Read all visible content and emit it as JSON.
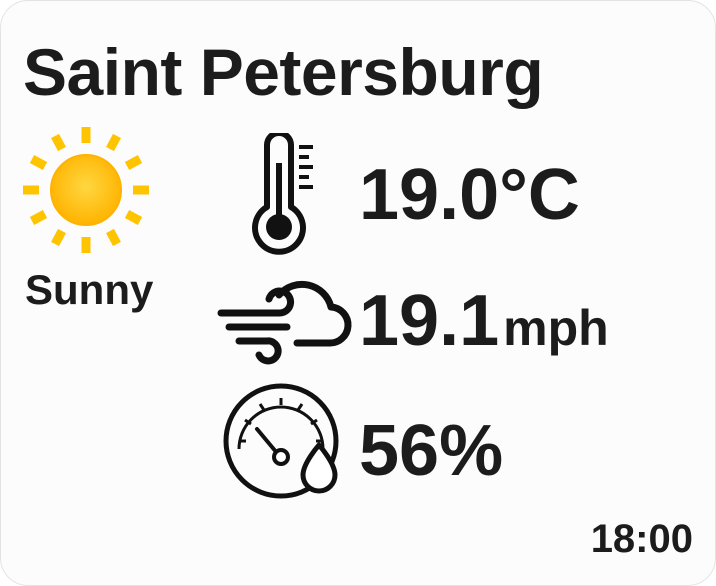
{
  "location": {
    "city": "Saint Petersburg"
  },
  "conditions": {
    "summary": "Sunny",
    "icon": "sun-icon"
  },
  "metrics": {
    "temperature": {
      "value": "19.0°C",
      "icon": "thermometer-icon"
    },
    "wind": {
      "value": "19.1",
      "unit": "mph",
      "icon": "wind-cloud-icon"
    },
    "humidity": {
      "value": "56%",
      "icon": "humidity-gauge-icon"
    }
  },
  "clock": {
    "time": "18:00"
  },
  "colors": {
    "sun_core": "#ffc400",
    "sun_rays": "#ffc400",
    "text": "#1c1c1c",
    "background": "#fdfcfd"
  }
}
